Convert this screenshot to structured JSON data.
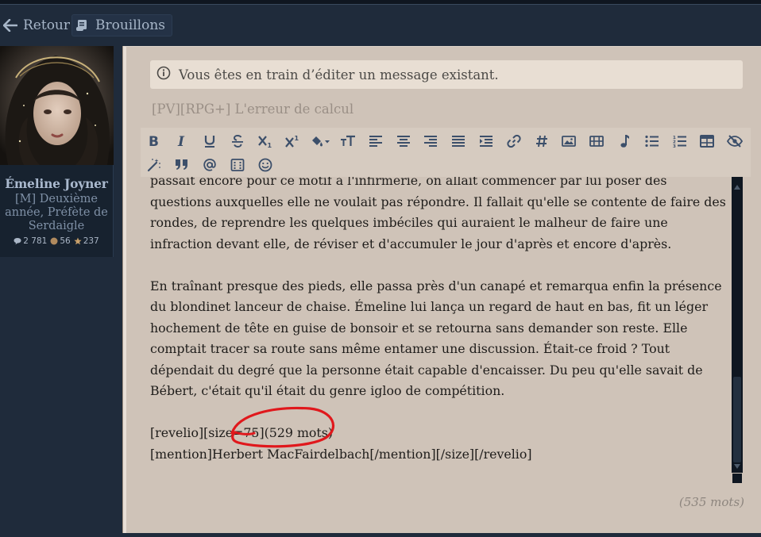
{
  "nav": {
    "back_label": "Retour",
    "drafts_label": "Brouillons"
  },
  "user": {
    "name": "Émeline Joyner",
    "rank": "[M] Deuxième année, Préfète de Serdaigle",
    "stats": {
      "messages": "2 781",
      "coins": "56",
      "stars": "237"
    }
  },
  "editor": {
    "info_text": "Vous êtes en train d’éditer un message existant.",
    "subject": "[PV][RPG+] L'erreur de calcul",
    "paragraphs": [
      "passait encore pour ce motif à l'infirmerie, on allait commencer par lui poser des questions auxquelles elle ne voulait pas répondre. Il fallait qu'elle se contente de faire des rondes, de reprendre les quelques imbéciles qui auraient le malheur de faire une infraction devant elle, de réviser et d'accumuler le jour d'après et encore d'après.",
      "En traînant presque des pieds, elle passa près d'un canapé et remarqua enfin la présence du blondinet lanceur de chaise. Émeline lui lança un regard de haut en bas, fit un léger hochement de tête en guise de bonsoir et se retourna sans demander son reste. Elle comptait tracer sa route sans même entamer une discussion. Était-ce froid ? Tout dépendait du degré que la personne était capable d'encaisser. Du peu qu'elle savait de Bébert, c'était qu'il était du genre igloo de compétition."
    ],
    "code_line_1": "[revelio][size=75](529 mots)",
    "code_line_2": "[mention]Herbert MacFairdelbach[/mention][/size][/revelio]",
    "word_count": "(535 mots)"
  },
  "toolbar_icons": [
    "bold-icon",
    "italic-icon",
    "underline-icon",
    "strikethrough-icon",
    "subscript-icon",
    "superscript-icon",
    "fill-color-icon",
    "font-size-icon",
    "align-left-icon",
    "align-center-icon",
    "align-right-icon",
    "align-justify-icon",
    "indent-icon",
    "link-icon",
    "hashtag-icon",
    "image-icon",
    "video-icon",
    "music-icon",
    "bullet-list-icon",
    "numbered-list-icon",
    "table-icon",
    "hide-icon",
    "clear-format-icon",
    "quote-icon",
    "mention-icon",
    "code-icon",
    "emoji-icon"
  ],
  "colors": {
    "background": "#1f2b3b",
    "editor_bg": "#cfc3b8",
    "toolbar_icon": "#3c4f6a",
    "annotation": "#e0181c"
  }
}
